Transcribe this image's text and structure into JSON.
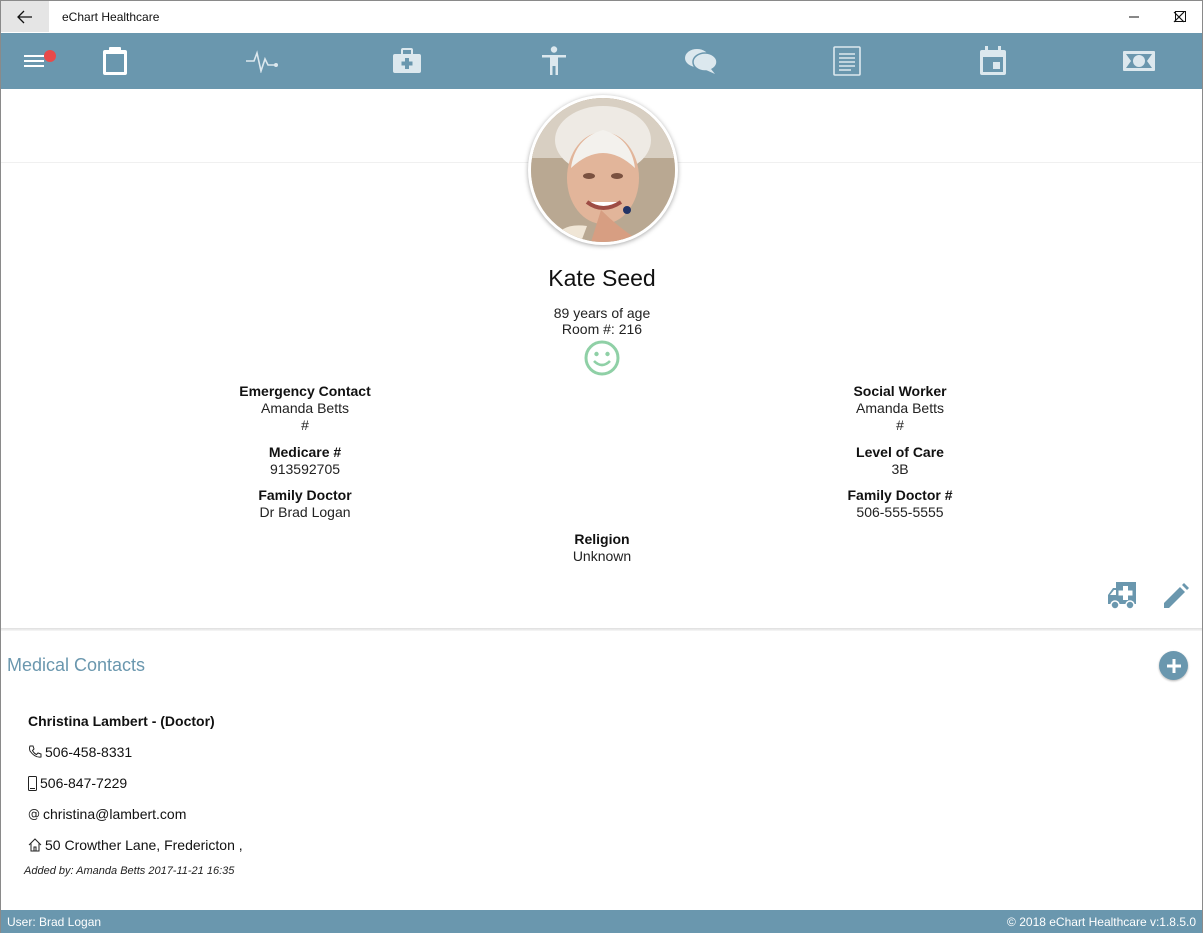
{
  "window": {
    "title": "eChart Healthcare"
  },
  "toolbar": {
    "items": [
      "menu-icon",
      "clipboard-icon",
      "vitals-icon",
      "medical-kit-icon",
      "body-icon",
      "chat-icon",
      "notes-icon",
      "calendar-icon",
      "billing-icon"
    ],
    "has_notification": true,
    "color": "#6a97ae"
  },
  "patient": {
    "name": "Kate Seed",
    "age": "89 years of age",
    "room": "Room #: 216",
    "mood": "happy-face-icon"
  },
  "fields": {
    "emergency_contact": {
      "label": "Emergency Contact",
      "name": "Amanda Betts",
      "phone": "#"
    },
    "social_worker": {
      "label": "Social Worker",
      "name": "Amanda Betts",
      "phone": "#"
    },
    "medicare": {
      "label": "Medicare #",
      "value": "913592705"
    },
    "level_of_care": {
      "label": "Level of Care",
      "value": "3B"
    },
    "family_doctor": {
      "label": "Family Doctor",
      "value": "Dr Brad Logan"
    },
    "family_doctor_phone": {
      "label": "Family Doctor #",
      "value": "506-555-5555"
    },
    "religion": {
      "label": "Religion",
      "value": "Unknown"
    }
  },
  "medical_contacts": {
    "title": "Medical Contacts",
    "contact": {
      "name": "Christina Lambert - (Doctor)",
      "phone": "506-458-8331",
      "mobile": "506-847-7229",
      "email": "christina@lambert.com",
      "address": "50 Crowther Lane, Fredericton ,",
      "added_by": "Added by: Amanda Betts 2017-11-21 16:35"
    }
  },
  "status": {
    "user": "User: Brad Logan",
    "copyright": "© 2018 eChart Healthcare v:1.8.5.0"
  }
}
